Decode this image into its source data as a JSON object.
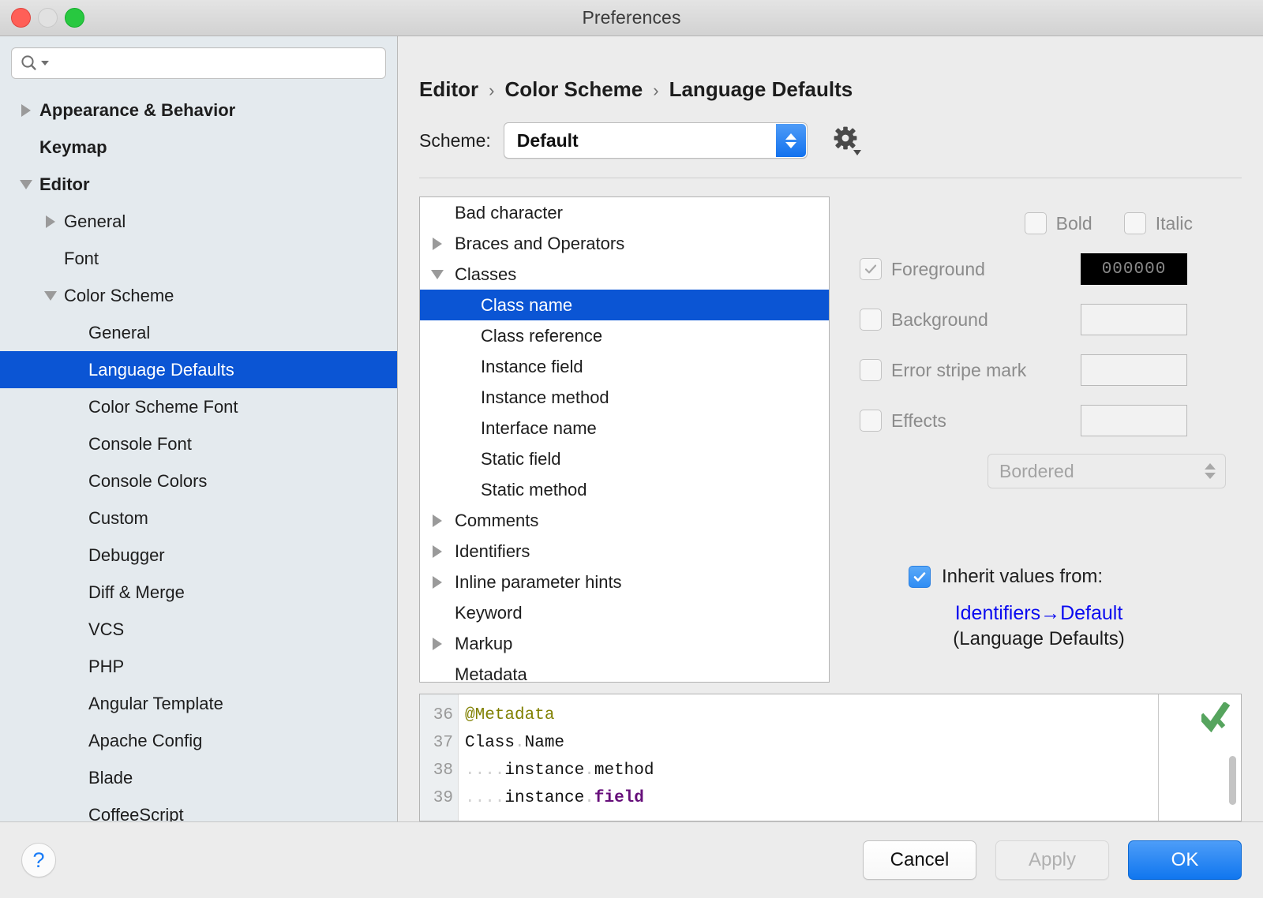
{
  "window": {
    "title": "Preferences",
    "traffic_lights": [
      "close",
      "minimize",
      "zoom"
    ]
  },
  "sidebar": {
    "search": {
      "value": "",
      "placeholder": ""
    },
    "items": [
      {
        "label": "Appearance & Behavior",
        "indent": 0,
        "twisty": "right",
        "bold": true,
        "selected": false
      },
      {
        "label": "Keymap",
        "indent": 0,
        "twisty": "none",
        "bold": true,
        "selected": false
      },
      {
        "label": "Editor",
        "indent": 0,
        "twisty": "down",
        "bold": true,
        "selected": false
      },
      {
        "label": "General",
        "indent": 1,
        "twisty": "right",
        "bold": false,
        "selected": false
      },
      {
        "label": "Font",
        "indent": 1,
        "twisty": "none",
        "bold": false,
        "selected": false
      },
      {
        "label": "Color Scheme",
        "indent": 1,
        "twisty": "down",
        "bold": false,
        "selected": false
      },
      {
        "label": "General",
        "indent": 2,
        "twisty": "none",
        "bold": false,
        "selected": false
      },
      {
        "label": "Language Defaults",
        "indent": 2,
        "twisty": "none",
        "bold": false,
        "selected": true
      },
      {
        "label": "Color Scheme Font",
        "indent": 2,
        "twisty": "none",
        "bold": false,
        "selected": false
      },
      {
        "label": "Console Font",
        "indent": 2,
        "twisty": "none",
        "bold": false,
        "selected": false
      },
      {
        "label": "Console Colors",
        "indent": 2,
        "twisty": "none",
        "bold": false,
        "selected": false
      },
      {
        "label": "Custom",
        "indent": 2,
        "twisty": "none",
        "bold": false,
        "selected": false
      },
      {
        "label": "Debugger",
        "indent": 2,
        "twisty": "none",
        "bold": false,
        "selected": false
      },
      {
        "label": "Diff & Merge",
        "indent": 2,
        "twisty": "none",
        "bold": false,
        "selected": false
      },
      {
        "label": "VCS",
        "indent": 2,
        "twisty": "none",
        "bold": false,
        "selected": false
      },
      {
        "label": "PHP",
        "indent": 2,
        "twisty": "none",
        "bold": false,
        "selected": false
      },
      {
        "label": "Angular Template",
        "indent": 2,
        "twisty": "none",
        "bold": false,
        "selected": false
      },
      {
        "label": "Apache Config",
        "indent": 2,
        "twisty": "none",
        "bold": false,
        "selected": false
      },
      {
        "label": "Blade",
        "indent": 2,
        "twisty": "none",
        "bold": false,
        "selected": false
      },
      {
        "label": "CoffeeScript",
        "indent": 2,
        "twisty": "none",
        "bold": false,
        "selected": false
      }
    ]
  },
  "breadcrumb": {
    "parts": [
      "Editor",
      "Color Scheme",
      "Language Defaults"
    ],
    "separator": "›"
  },
  "scheme": {
    "label": "Scheme:",
    "value": "Default",
    "gear_icon": "gear-icon"
  },
  "attribute_tree": {
    "items": [
      {
        "label": "Bad character",
        "indent": 1,
        "twisty": "none",
        "selected": false
      },
      {
        "label": "Braces and Operators",
        "indent": 1,
        "twisty": "right",
        "selected": false
      },
      {
        "label": "Classes",
        "indent": 1,
        "twisty": "down",
        "selected": false
      },
      {
        "label": "Class name",
        "indent": 2,
        "twisty": "none",
        "selected": true
      },
      {
        "label": "Class reference",
        "indent": 2,
        "twisty": "none",
        "selected": false
      },
      {
        "label": "Instance field",
        "indent": 2,
        "twisty": "none",
        "selected": false
      },
      {
        "label": "Instance method",
        "indent": 2,
        "twisty": "none",
        "selected": false
      },
      {
        "label": "Interface name",
        "indent": 2,
        "twisty": "none",
        "selected": false
      },
      {
        "label": "Static field",
        "indent": 2,
        "twisty": "none",
        "selected": false
      },
      {
        "label": "Static method",
        "indent": 2,
        "twisty": "none",
        "selected": false
      },
      {
        "label": "Comments",
        "indent": 1,
        "twisty": "right",
        "selected": false
      },
      {
        "label": "Identifiers",
        "indent": 1,
        "twisty": "right",
        "selected": false
      },
      {
        "label": "Inline parameter hints",
        "indent": 1,
        "twisty": "right",
        "selected": false
      },
      {
        "label": "Keyword",
        "indent": 1,
        "twisty": "none",
        "selected": false
      },
      {
        "label": "Markup",
        "indent": 1,
        "twisty": "right",
        "selected": false
      },
      {
        "label": "Metadata",
        "indent": 1,
        "twisty": "none",
        "selected": false
      }
    ]
  },
  "attributes": {
    "bold": {
      "label": "Bold",
      "checked": false,
      "enabled": false
    },
    "italic": {
      "label": "Italic",
      "checked": false,
      "enabled": false
    },
    "rows": [
      {
        "label": "Foreground",
        "checked": true,
        "enabled": false,
        "color": "000000",
        "swatch_black": true
      },
      {
        "label": "Background",
        "checked": false,
        "enabled": false,
        "color": "",
        "swatch_black": false
      },
      {
        "label": "Error stripe mark",
        "checked": false,
        "enabled": false,
        "color": "",
        "swatch_black": false
      },
      {
        "label": "Effects",
        "checked": false,
        "enabled": false,
        "color": "",
        "swatch_black": false
      }
    ],
    "effect_type": "Bordered",
    "inherit": {
      "checked": true,
      "label": "Inherit values from:",
      "link": "Identifiers→Default",
      "sub": "(Language Defaults)"
    }
  },
  "preview": {
    "lines": [
      {
        "no": "36",
        "parts": [
          {
            "t": "@Metadata",
            "c": "anno"
          }
        ]
      },
      {
        "no": "37",
        "parts": [
          {
            "t": "Class",
            "c": ""
          },
          {
            "t": ".",
            "c": "dot2"
          },
          {
            "t": "Name",
            "c": ""
          }
        ]
      },
      {
        "no": "38",
        "parts": [
          {
            "t": "....",
            "c": "ws"
          },
          {
            "t": "instance",
            "c": ""
          },
          {
            "t": ".",
            "c": "dot2"
          },
          {
            "t": "method",
            "c": ""
          }
        ]
      },
      {
        "no": "39",
        "parts": [
          {
            "t": "....",
            "c": "ws"
          },
          {
            "t": "instance",
            "c": ""
          },
          {
            "t": ".",
            "c": "dot2"
          },
          {
            "t": "field",
            "c": "fld"
          }
        ]
      }
    ],
    "inspection_icon": "green-check-icon"
  },
  "footer": {
    "help": "?",
    "cancel": "Cancel",
    "apply": "Apply",
    "apply_enabled": false,
    "ok": "OK"
  },
  "colors": {
    "selection_blue": "#0b55d4",
    "accent_blue": "#1076ef",
    "link_blue": "#0a0af0",
    "sidebar_bg": "#e4eaee",
    "panel_bg": "#ececec"
  }
}
